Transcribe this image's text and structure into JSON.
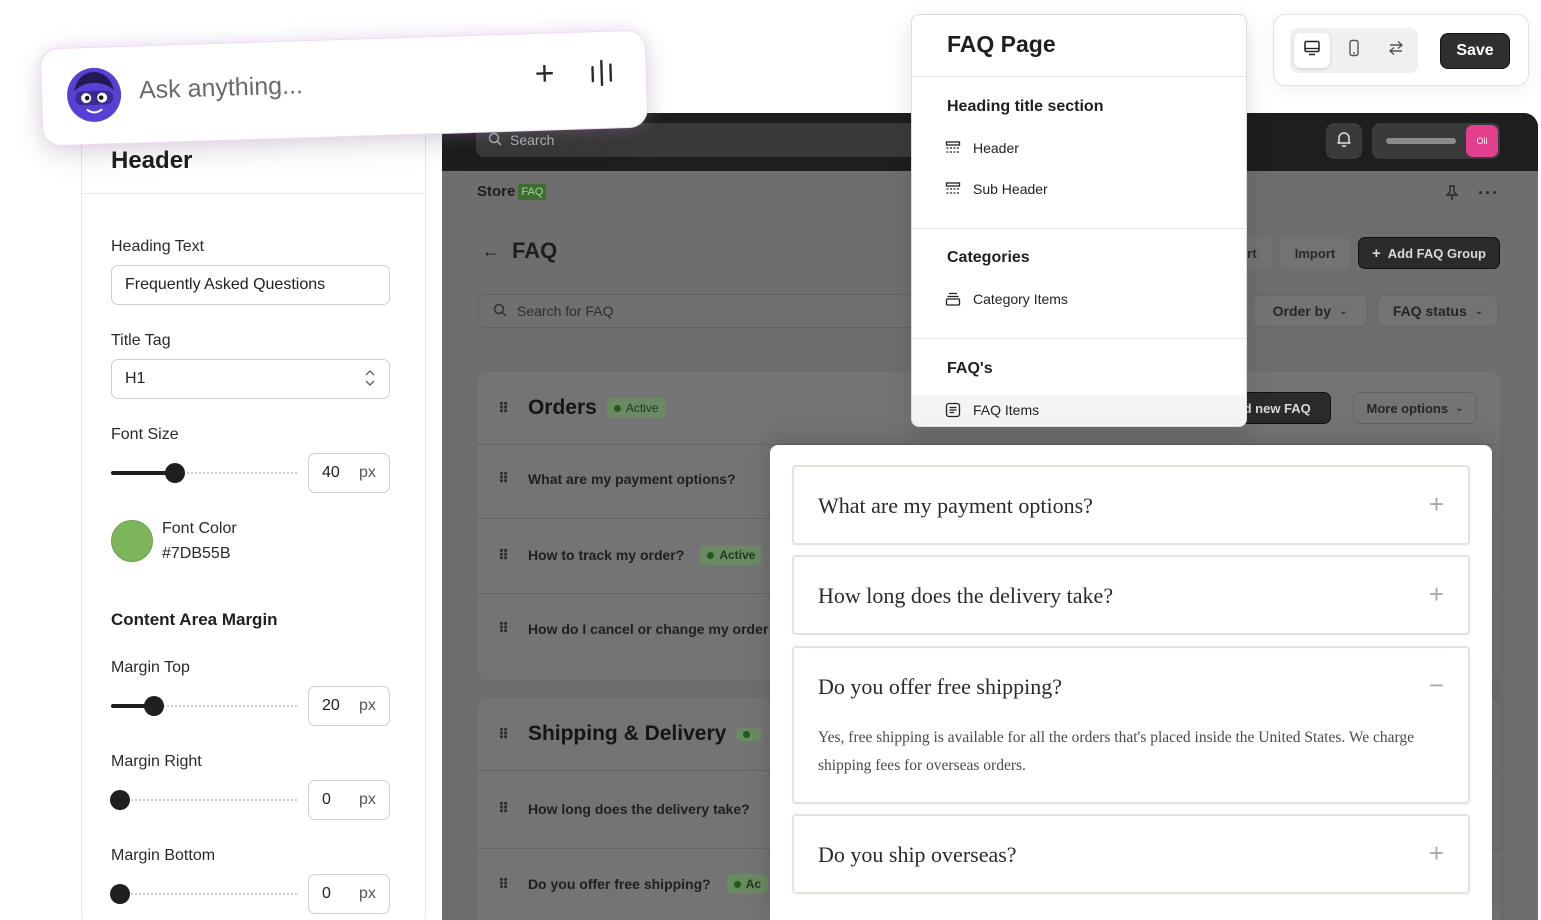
{
  "colors": {
    "font_color": "#7DB55B",
    "accent_pink": "#E2408C",
    "dark_button": "#2F2F2F"
  },
  "ask_bar": {
    "placeholder": "Ask anything...",
    "add_icon": "plus-icon",
    "voice_icon": "voice-bars-icon",
    "avatar_icon": "masked-mascot-avatar"
  },
  "settings_panel": {
    "title": "Header",
    "heading_text_label": "Heading Text",
    "heading_text_value": "Frequently Asked Questions",
    "title_tag_label": "Title Tag",
    "title_tag_value": "H1",
    "font_size_label": "Font Size",
    "font_size_value": "40",
    "font_size_fraction": 0.34,
    "unit": "px",
    "font_color_label": "Font Color",
    "font_color_value": "#7DB55B",
    "content_margin_section": "Content Area Margin",
    "margin_top_label": "Margin Top",
    "margin_top_value": "20",
    "margin_top_fraction": 0.23,
    "margin_right_label": "Margin Right",
    "margin_right_value": "0",
    "margin_right_fraction": 0.05,
    "margin_bottom_label": "Margin Bottom",
    "margin_bottom_value": "0",
    "margin_bottom_fraction": 0.05
  },
  "structure_panel": {
    "title": "FAQ Page",
    "sections": [
      {
        "heading": "Heading title section",
        "items": [
          "Header",
          "Sub Header"
        ]
      },
      {
        "heading": "Categories",
        "items": [
          "Category Items"
        ]
      },
      {
        "heading": "FAQ's",
        "items": [
          "FAQ Items"
        ]
      }
    ],
    "selected_item": "FAQ Items"
  },
  "toolbar": {
    "devices": [
      "desktop-icon",
      "mobile-icon",
      "swap-arrows-icon"
    ],
    "active_device": "desktop",
    "save_label": "Save"
  },
  "admin": {
    "search_placeholder": "Search",
    "avatar_initials": "Oli",
    "brand_text": "Store",
    "brand_tag": "FAQ",
    "page_title": "FAQ",
    "export_partial": "rt",
    "import_label": "Import",
    "add_group_label": "Add FAQ Group",
    "faq_search_placeholder": "Search for FAQ",
    "order_by_label": "Order by",
    "status_filter_label": "FAQ status",
    "groups": [
      {
        "title": "Orders",
        "status": "Active",
        "add_faq_partial": "ld new FAQ",
        "more_options_label": "More options",
        "questions": [
          {
            "text": "What are my payment options?",
            "status": ""
          },
          {
            "text": "How to track my order?",
            "status": "Active"
          },
          {
            "text": "How do I cancel or change my order",
            "status": ""
          }
        ]
      },
      {
        "title": "Shipping & Delivery",
        "status": "",
        "questions": [
          {
            "text": "How long does the delivery take?",
            "status": ""
          },
          {
            "text": "Do you offer free shipping?",
            "status": "Ac"
          }
        ]
      }
    ]
  },
  "preview": {
    "items": [
      {
        "question": "What are my payment options?",
        "toggle": "+"
      },
      {
        "question": "How long does the delivery take?",
        "toggle": "+"
      },
      {
        "question": "Do you offer free shipping?",
        "toggle": "−",
        "answer": "Yes, free shipping is available for all the orders that's placed inside the United States. We charge shipping fees for overseas orders."
      },
      {
        "question": "Do you ship overseas?",
        "toggle": "+"
      }
    ]
  }
}
